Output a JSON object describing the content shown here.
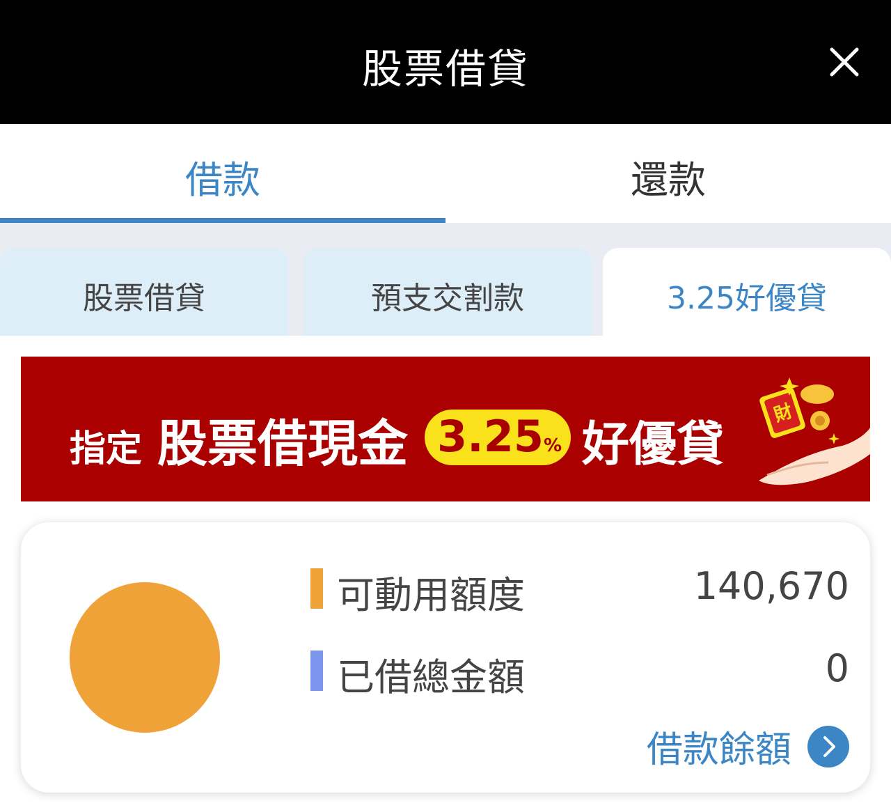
{
  "header": {
    "title": "股票借貸",
    "close_icon": "close-icon"
  },
  "main_tabs": [
    {
      "label": "借款",
      "active": true
    },
    {
      "label": "還款",
      "active": false
    }
  ],
  "sub_tabs": [
    {
      "label": "股票借貸",
      "active": false
    },
    {
      "label": "預支交割款",
      "active": false
    },
    {
      "label": "3.25好優貸",
      "active": true
    }
  ],
  "banner": {
    "prefix": "指定",
    "headline": "股票借現金",
    "rate": "3.25",
    "rate_unit": "%",
    "suffix": "好優貸",
    "deco_text": "財",
    "background": "#ab0000",
    "accent": "#f9e11b"
  },
  "summary": {
    "rows": [
      {
        "label": "可動用額度",
        "value": "140,670",
        "color": "#efa238"
      },
      {
        "label": "已借總金額",
        "value": "0",
        "color": "#7b96ec"
      }
    ],
    "pie_share_available": 1.0,
    "balance_link": "借款餘額",
    "balance_icon": "chevron-right-icon"
  },
  "colors": {
    "accent": "#3d86c6",
    "header_bg": "#000000"
  }
}
